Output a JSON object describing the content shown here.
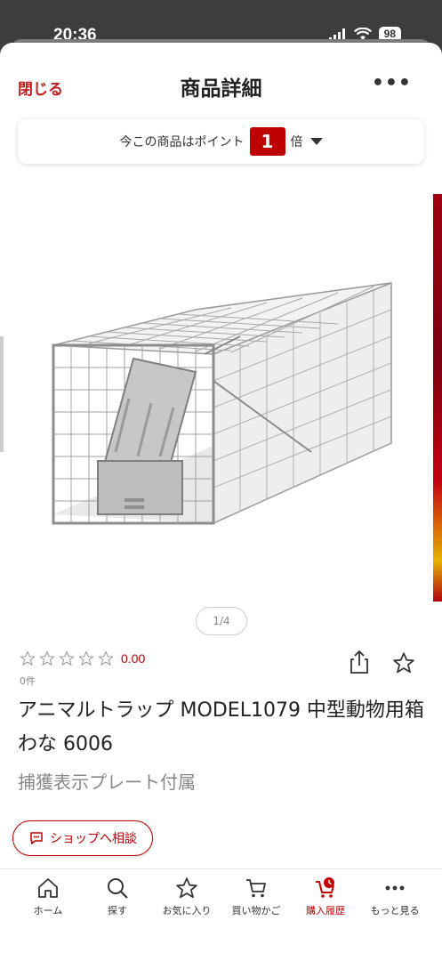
{
  "status_bar": {
    "time": "20:36",
    "battery": "98"
  },
  "header": {
    "close_label": "閉じる",
    "title": "商品詳細",
    "more_label": "•••"
  },
  "points": {
    "prefix": "今この商品はポイント",
    "multiplier": "1",
    "suffix": "倍"
  },
  "gallery": {
    "pager": "1/4"
  },
  "rating": {
    "stars_filled": 0,
    "stars_total": 5,
    "value": "0.00",
    "review_count": "0件"
  },
  "product": {
    "name": "アニマルトラップ MODEL1079 中型動物用箱わな 6006",
    "catch_copy": "捕獲表示プレート付属"
  },
  "consult_button": {
    "label": "ショップへ相談"
  },
  "tab_bar": {
    "tabs": [
      {
        "label": "ホーム",
        "icon": "home-icon"
      },
      {
        "label": "探す",
        "icon": "search-icon"
      },
      {
        "label": "お気に入り",
        "icon": "star-icon"
      },
      {
        "label": "買い物かご",
        "icon": "cart-icon"
      },
      {
        "label": "購入履歴",
        "icon": "purchase-history-icon"
      },
      {
        "label": "もっと見る",
        "icon": "more-icon"
      }
    ],
    "active_index": 4
  },
  "colors": {
    "accent": "#bf0000",
    "text": "#222222",
    "muted": "#888888"
  }
}
